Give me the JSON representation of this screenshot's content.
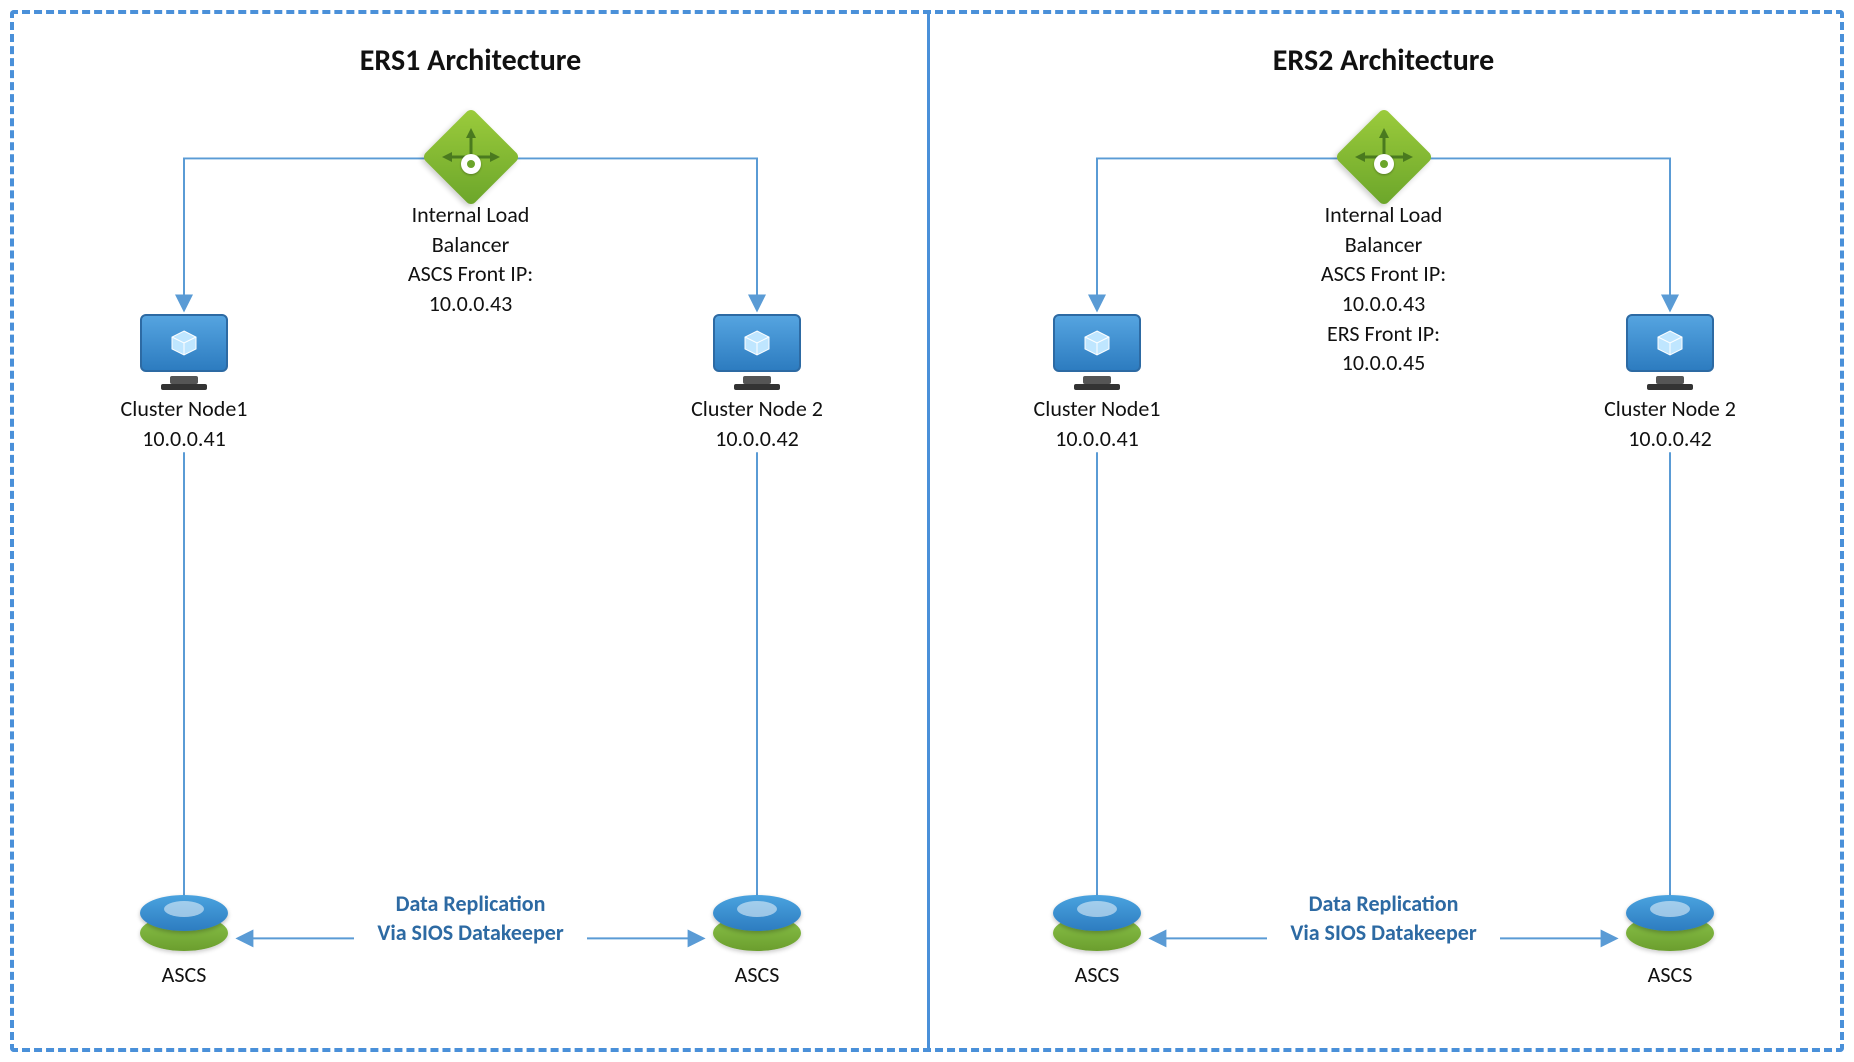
{
  "panels": [
    {
      "title": "ERS1 Architecture",
      "lb": {
        "lines": [
          "Internal Load",
          "Balancer",
          "ASCS Front IP:",
          "10.0.0.43"
        ]
      },
      "node1": {
        "name": "Cluster Node1",
        "ip": "10.0.0.41"
      },
      "node2": {
        "name": "Cluster Node 2",
        "ip": "10.0.0.42"
      },
      "disk_label": "ASCS",
      "repl": [
        "Data Replication",
        "Via SIOS Datakeeper"
      ]
    },
    {
      "title": "ERS2 Architecture",
      "lb": {
        "lines": [
          "Internal Load",
          "Balancer",
          "ASCS Front IP:",
          "10.0.0.43",
          "ERS Front IP:",
          "10.0.0.45"
        ]
      },
      "node1": {
        "name": "Cluster Node1",
        "ip": "10.0.0.41"
      },
      "node2": {
        "name": "Cluster Node 2",
        "ip": "10.0.0.42"
      },
      "disk_label": "ASCS",
      "repl": [
        "Data Replication",
        "Via SIOS Datakeeper"
      ]
    }
  ]
}
